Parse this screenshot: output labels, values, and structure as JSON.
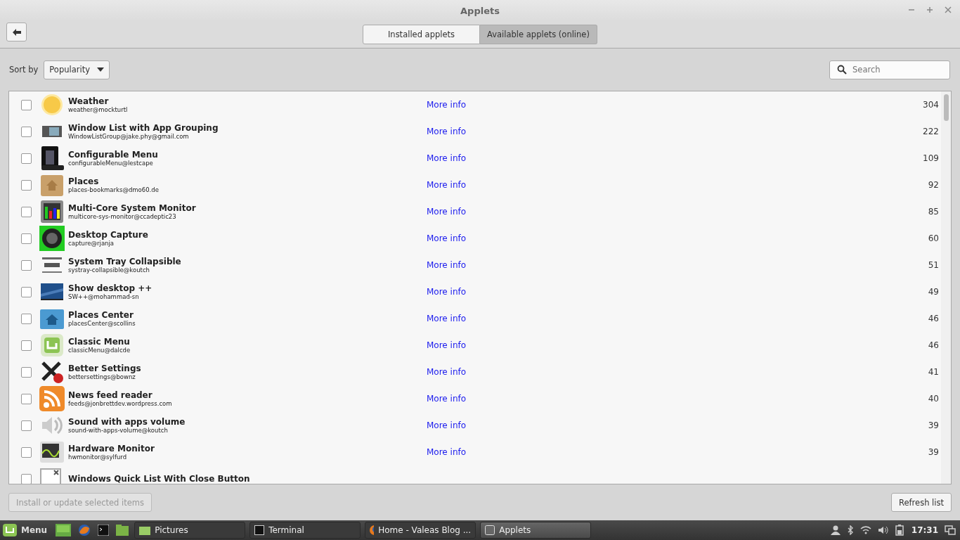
{
  "window": {
    "title": "Applets"
  },
  "tabs": [
    {
      "label": "Installed applets",
      "selected": false
    },
    {
      "label": "Available applets (online)",
      "selected": true
    }
  ],
  "sort": {
    "label": "Sort by",
    "value": "Popularity"
  },
  "search": {
    "placeholder": "Search"
  },
  "applets": [
    {
      "name": "Weather",
      "uuid": "weather@mockturtl",
      "link": "More info",
      "score": "304",
      "checked": false
    },
    {
      "name": "Window List with App Grouping",
      "uuid": "WindowListGroup@jake.phy@gmail.com",
      "link": "More info",
      "score": "222",
      "checked": false
    },
    {
      "name": "Configurable Menu",
      "uuid": "configurableMenu@lestcape",
      "link": "More info",
      "score": "109",
      "checked": false
    },
    {
      "name": "Places",
      "uuid": "places-bookmarks@dmo60.de",
      "link": "More info",
      "score": "92",
      "checked": false
    },
    {
      "name": "Multi-Core System Monitor",
      "uuid": "multicore-sys-monitor@ccadeptic23",
      "link": "More info",
      "score": "85",
      "checked": false
    },
    {
      "name": "Desktop Capture",
      "uuid": "capture@rjanja",
      "link": "More info",
      "score": "60",
      "checked": false
    },
    {
      "name": "System Tray Collapsible",
      "uuid": "systray-collapsible@koutch",
      "link": "More info",
      "score": "51",
      "checked": false
    },
    {
      "name": "Show desktop ++",
      "uuid": "SW++@mohammad-sn",
      "link": "More info",
      "score": "49",
      "checked": false
    },
    {
      "name": "Places Center",
      "uuid": "placesCenter@scollins",
      "link": "More info",
      "score": "46",
      "checked": false
    },
    {
      "name": "Classic Menu",
      "uuid": "classicMenu@dalcde",
      "link": "More info",
      "score": "46",
      "checked": false
    },
    {
      "name": "Better Settings",
      "uuid": "bettersettings@bownz",
      "link": "More info",
      "score": "41",
      "checked": false
    },
    {
      "name": "News feed reader",
      "uuid": "feeds@jonbrettdev.wordpress.com",
      "link": "More info",
      "score": "40",
      "checked": false
    },
    {
      "name": "Sound with apps volume",
      "uuid": "sound-with-apps-volume@koutch",
      "link": "More info",
      "score": "39",
      "checked": false
    },
    {
      "name": "Hardware Monitor",
      "uuid": "hwmonitor@sylfurd",
      "link": "More info",
      "score": "39",
      "checked": false
    },
    {
      "name": "Windows Quick List With Close Button",
      "checked": false
    }
  ],
  "buttons": {
    "install": {
      "label": "Install or update selected items",
      "disabled": true
    },
    "refresh": {
      "label": "Refresh list",
      "disabled": false
    }
  },
  "taskbar": {
    "menu": "Menu",
    "windows": [
      {
        "label": "Pictures",
        "selected": false
      },
      {
        "label": "Terminal",
        "selected": false
      },
      {
        "label": "Home - Valeas Blog ...",
        "selected": false
      },
      {
        "label": "Applets",
        "selected": true
      }
    ],
    "clock": "17:31"
  }
}
